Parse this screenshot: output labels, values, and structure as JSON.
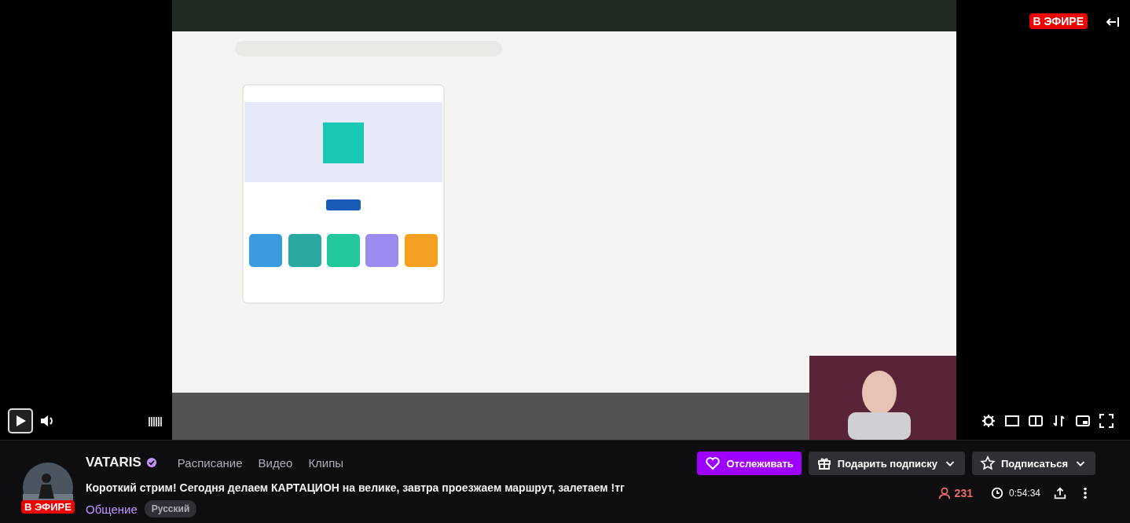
{
  "player": {
    "live_badge": "В ЭФИРЕ"
  },
  "channel": {
    "name": "VATARIS",
    "verified": true,
    "live_badge": "В ЭФИРЕ",
    "nav": [
      "Расписание",
      "Видео",
      "Клипы"
    ],
    "title": "Короткий стрим! Сегодня делаем КАРТАЦИОН на велике, завтра проезжаем маршрут, залетаем !тг",
    "category": "Общение",
    "tags": [
      "Русский"
    ]
  },
  "actions": {
    "follow": "Отслеживать",
    "gift": "Подарить подписку",
    "subscribe": "Подписаться"
  },
  "stats": {
    "viewers": "231",
    "uptime": "0:54:34"
  }
}
